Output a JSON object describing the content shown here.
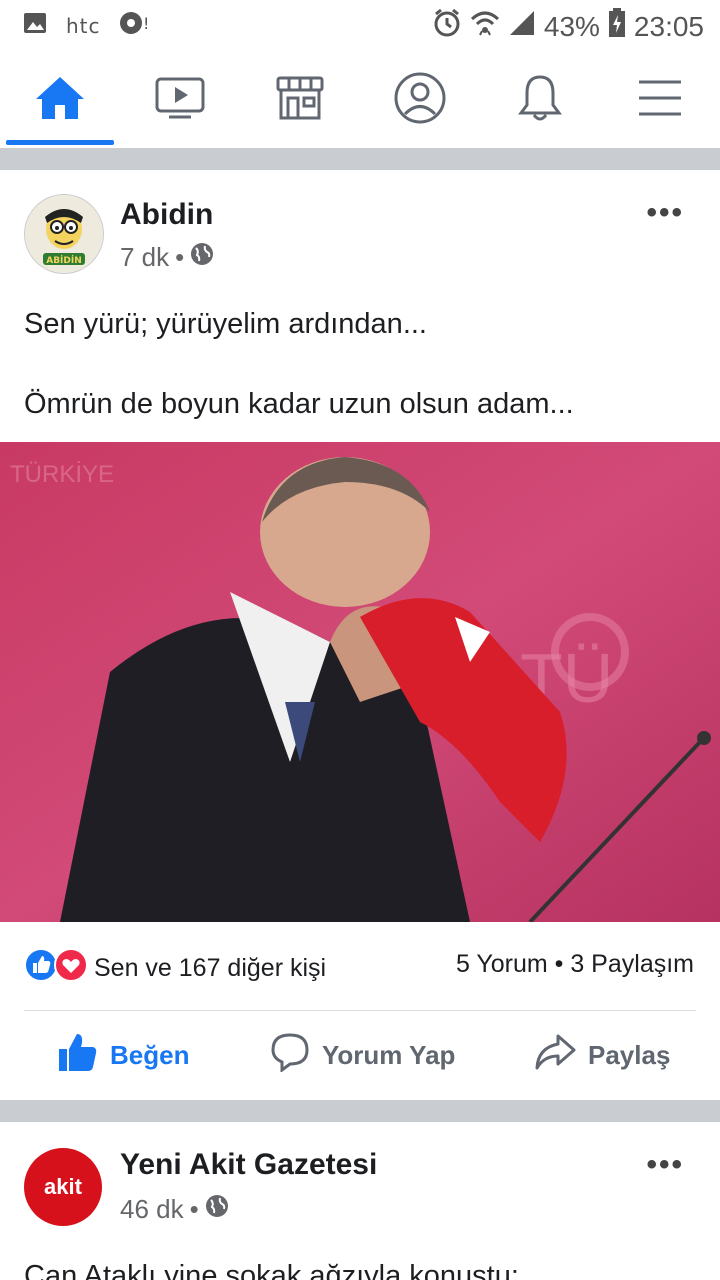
{
  "status_bar": {
    "carrier": "htc",
    "battery_percent": "43%",
    "time": "23:05",
    "icons": [
      "image-icon",
      "vodafone-icon",
      "alarm-icon",
      "wifi-icon",
      "signal-icon",
      "battery-charging-icon"
    ]
  },
  "nav": {
    "tabs": [
      "home-icon",
      "watch-icon",
      "marketplace-icon",
      "profile-icon",
      "notifications-icon",
      "menu-icon"
    ],
    "active_tab": "home-icon",
    "accent_color": "#1877f2"
  },
  "post1": {
    "author": "Abidin",
    "avatar_text": "ABİDİN",
    "time": "7 dk",
    "audience_icon": "globe-icon",
    "more": "•••",
    "text_line1": "Sen yürü; yürüyelim ardından...",
    "text_line2": "Ömrün de boyun kadar uzun olsun adam...",
    "reactions_text": "Sen ve 167 diğer kişi",
    "counts_text": "5 Yorum • 3 Paylaşım",
    "actions": {
      "like": "Beğen",
      "comment": "Yorum Yap",
      "share": "Paylaş"
    }
  },
  "post2": {
    "author": "Yeni Akit Gazetesi",
    "avatar_text": "akit",
    "time": "46 dk",
    "audience_icon": "globe-icon",
    "more": "•••",
    "text_line1": "Can Ataklı yine sokak ağzıyla konuştu:"
  }
}
